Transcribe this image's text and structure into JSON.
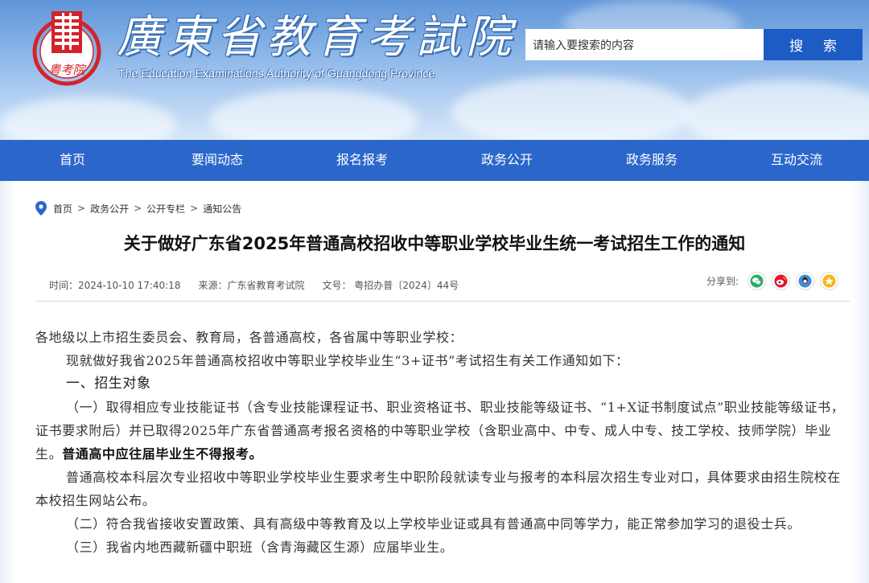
{
  "header": {
    "title_cn": "廣東省教育考試院",
    "title_en": "The Education Examinations Authority of Guangdong Province",
    "logo_text": "粤考院",
    "search_placeholder": "请输入要搜索的内容",
    "search_button": "搜 索"
  },
  "nav": {
    "items": [
      "首页",
      "要闻动态",
      "报名报考",
      "政务公开",
      "政务服务",
      "互动交流"
    ]
  },
  "breadcrumb": {
    "items": [
      "首页",
      "政务公开",
      "公开专栏",
      "通知公告"
    ],
    "separator": ">"
  },
  "article": {
    "title": "关于做好广东省2025年普通高校招收中等职业学校毕业生统一考试招生工作的通知",
    "meta": {
      "time": "时间：2024-10-10 17:40:18",
      "source": "来源：广东省教育考试院",
      "doc_no": "文号： 粤招办普〔2024〕44号"
    },
    "share_label": "分享到:",
    "share_icons": [
      "wechat-icon",
      "weibo-icon",
      "qq-icon",
      "qzone-icon"
    ],
    "paragraphs": {
      "p1": "各地级以上市招生委员会、教育局，各普通高校，各省属中等职业学校：",
      "p2": "现就做好我省2025年普通高校招收中等职业学校毕业生“3+证书”考试招生有关工作通知如下：",
      "h1": "一、招生对象",
      "p3_text": "（一）取得相应专业技能证书（含专业技能课程证书、职业资格证书、职业技能等级证书、“1+X证书制度试点”职业技能等级证书，证书要求附后）并已取得2025年广东省普通高考报名资格的中等职业学校（含职业高中、中专、成人中专、技工学校、技师学院）毕业生。",
      "p3_bold": "普通高中应往届毕业生不得报考。",
      "p4": "普通高校本科层次专业招收中等职业学校毕业生要求考生中职阶段就读专业与报考的本科层次招生专业对口，具体要求由招生院校在本校招生网站公布。",
      "p5": "（二）符合我省接收安置政策、具有高级中等教育及以上学校毕业证或具有普通高中同等学力，能正常参加学习的退役士兵。",
      "p6": "（三）我省内地西藏新疆中职班（含青海藏区生源）应届毕业生。"
    }
  },
  "colors": {
    "nav_bg": "#2b67cb",
    "search_button_bg": "#1d5bc5",
    "logo_red": "#d3232a",
    "share_wechat": "#2aae67",
    "share_weibo": "#e6162d",
    "share_qq": "#3a8fdc",
    "share_qzone": "#f4b619"
  }
}
